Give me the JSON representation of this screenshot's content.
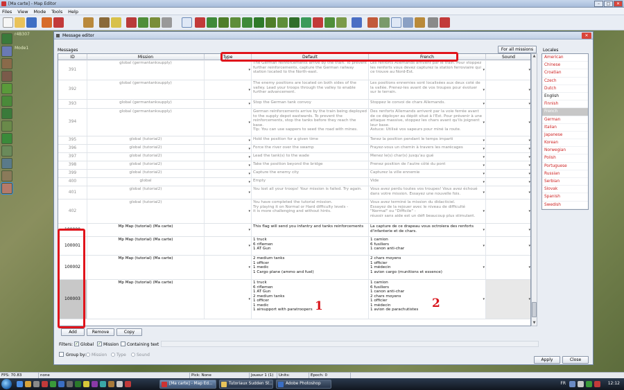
{
  "window": {
    "title": "[Ma carte] - Map Editor"
  },
  "menu": [
    "Files",
    "View",
    "Mode",
    "Tools",
    "Help"
  ],
  "map_labels": {
    "coords": "r4B307",
    "mode": "Mode1"
  },
  "dialog": {
    "title": "Message editor",
    "messages_label": "Messages",
    "for_all_missions": "For all missions",
    "locales_label": "Locales",
    "columns": [
      "ID",
      "Mission",
      "Type",
      "Default",
      "French",
      "Sound"
    ],
    "rows": [
      {
        "id": "391",
        "mission": "global (germantanksupply)",
        "default": "The German reinforcements arrive by the train. To prevent further reinforcements, capture the German railway station located to the North-east.",
        "french": "Les renforts Allemands arrivent par le train. Pour stoppez les renforts vous devez capturez la station ferroviaire qui ce trouve au Nord-Est."
      },
      {
        "id": "392",
        "mission": "global (germantanksupply)",
        "default": "The enemy positions are located on both sides of the valley. Lead your troops through the valley to enable further advancement.",
        "french": "Les positions ennemies sont localisées aux deux coté de la vallée. Prenez-les avant de vos troupes pour évoluer sur le terrain."
      },
      {
        "id": "393",
        "mission": "global (germantanksupply)",
        "default": "Stop the German tank convoy",
        "french": "Stoppez le convoi de chars Allemands."
      },
      {
        "id": "394",
        "mission": "global (germantanksupply)",
        "default": "German reinforcements arrive by the train being deployed to the supply depot eastwards. To prevent the reinforcements, stop the tanks before they reach the base.\nTip: You can use sappers to seed the road with mines.",
        "french": "Des renforts Allemands arrivent par la voie ferrée avant de ce déployer au dépôt situé à l'Est. Pour prévenir à une attaque massive, stoppez les chars avant qu'ils joignent leur base.\nAstuce: Utilisé vos sapeurs pour miné la route."
      },
      {
        "id": "395",
        "mission": "global (tutorial2)",
        "default": "Hold the position for a given time",
        "french": "Tenez la position pendant le temps imparti"
      },
      {
        "id": "396",
        "mission": "global (tutorial2)",
        "default": "Force the river over the swamp",
        "french": "Frayez-vous un chemin à travers les marécages"
      },
      {
        "id": "397",
        "mission": "global (tutorial2)",
        "default": "Lead the tank(s) to the wade",
        "french": "Menez le(s) char(s) jusqu'au gué"
      },
      {
        "id": "398",
        "mission": "global (tutorial2)",
        "default": "Take the position beyond the bridge",
        "french": "Prenez position de l'autre côté du pont"
      },
      {
        "id": "399",
        "mission": "global (tutorial2)",
        "default": "Capture the enemy city",
        "french": "Capturez la ville ennemie"
      },
      {
        "id": "400",
        "mission": "global",
        "default": "Empty",
        "french": "Vide"
      },
      {
        "id": "401",
        "mission": "global (tutorial2)",
        "default": "You lost all your troops! Your mission is failed. Try again.",
        "french": "Vous avez perdu toutes vos troupes! Vous avez échoué dans votre mission. Essayez une nouvelle fois."
      },
      {
        "id": "402",
        "mission": "global (tutorial2)",
        "default": "You have completed the tutorial mission.\nTry playing it on Normal or Hard difficulty levels -\nit is more challenging and without hints.",
        "french": "Vous avez terminé la mission du didacticiel.\nEssayez de la rejouer avec le niveau de difficulté\n\"Normal\" ou \"Difficile\" -\nréussir sans aide est un défi beaucoup plus stimulant."
      },
      {
        "id": "100000",
        "mission": "Mp Map (tutorial) (Ma carte)",
        "default": "This flag will send you infantry and tanks reinforcements",
        "french": "La capture de ce drapeau vous octroiera des renforts d'infanterie et de chars."
      },
      {
        "id": "100001",
        "mission": "Mp Map (tutorial) (Ma carte)",
        "default": "1 truck\n6 riflemen\n1 AT Gun",
        "french": "1 camion\n6 fusiliers\n1 canon anti-char"
      },
      {
        "id": "100002",
        "mission": "Mp Map (tutorial) (Ma carte)",
        "default": "2 medium tanks\n1 officer\n1 medic\n1 Cargo plane (ammo and fuel)",
        "french": "2 chars moyens\n1 officier\n1 médecin\n1 avion cargo (munitions et essence)"
      },
      {
        "id": "100003",
        "mission": "Mp Map (tutorial) (Ma carte)",
        "default": "1 truck\n6 riflemen\n1 AT Gun\n2 medium tanks\n1 officer\n1 medic\n1 airsupport with paratroopers",
        "french": "1 camion\n6 fusiliers\n1 canon anti-char\n2 chars moyens\n1 officier\n1 médecin\n1 avion de parachutistes"
      }
    ],
    "buttons": {
      "add": "Add",
      "remove": "Remove",
      "copy": "Copy",
      "apply": "Apply",
      "close": "Close"
    },
    "filters": {
      "label": "Filters:",
      "global": "Global",
      "mission": "Mission",
      "containing": "Containing text"
    },
    "group_by": {
      "label": "Group by:",
      "options": [
        "Mission",
        "Type",
        "Sound"
      ]
    },
    "locales": [
      {
        "name": "American",
        "state": "red"
      },
      {
        "name": "Chinese",
        "state": "red"
      },
      {
        "name": "Croatian",
        "state": "red"
      },
      {
        "name": "Czech",
        "state": "red"
      },
      {
        "name": "Dutch",
        "state": "red"
      },
      {
        "name": "English",
        "state": "black"
      },
      {
        "name": "Finnish",
        "state": "red"
      },
      {
        "name": "French",
        "state": "selected"
      },
      {
        "name": "German",
        "state": "red"
      },
      {
        "name": "Italian",
        "state": "red"
      },
      {
        "name": "Japanese",
        "state": "red"
      },
      {
        "name": "Korean",
        "state": "red"
      },
      {
        "name": "Norwegian",
        "state": "red"
      },
      {
        "name": "Polish",
        "state": "red"
      },
      {
        "name": "Portuguese",
        "state": "red"
      },
      {
        "name": "Russian",
        "state": "red"
      },
      {
        "name": "Serbian",
        "state": "red"
      },
      {
        "name": "Slovak",
        "state": "red"
      },
      {
        "name": "Spanish",
        "state": "red"
      },
      {
        "name": "Swedish",
        "state": "red"
      }
    ],
    "annotations": {
      "one": "1",
      "two": "2"
    }
  },
  "status": {
    "fps": "FPS: 70.83",
    "none": "none",
    "pick": "Pick: None",
    "player": "Joueur 1 (1)",
    "units": "Units:",
    "epoch": "Epoch: 0"
  },
  "taskbar": {
    "tasks": [
      "[Ma carte] - Map Ed...",
      "Tutoriaux Sudden St...",
      "Adobe Photoshop"
    ],
    "lang": "FR",
    "clock": "12:12"
  },
  "colors": {
    "annotation_red": "#e0141b",
    "missing_locale": "#cc1e1e"
  }
}
